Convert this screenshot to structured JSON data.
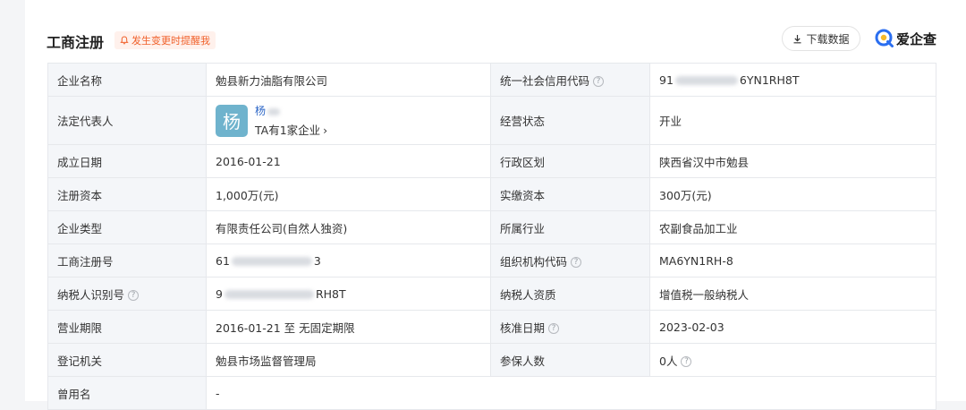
{
  "header": {
    "title": "工商注册",
    "remind_label": "发生变更时提醒我",
    "download_label": "下载数据",
    "brand_name": "爱企查",
    "bell_icon": "bell-icon",
    "download_icon": "download-icon",
    "brand_logo": "aiqicha-logo"
  },
  "rows": [
    {
      "l1": "企业名称",
      "v1": "勉县新力油脂有限公司",
      "l2": "统一社会信用代码",
      "v2_prefix": "91",
      "v2_suffix": "6YN1RH8T"
    },
    {
      "l1": "法定代表人",
      "avatar_char": "杨",
      "rep_name": "杨",
      "rep_sub": "TA有1家企业",
      "l2": "经营状态",
      "v2": "开业"
    },
    {
      "l1": "成立日期",
      "v1": "2016-01-21",
      "l2": "行政区划",
      "v2": "陕西省汉中市勉县"
    },
    {
      "l1": "注册资本",
      "v1": "1,000万(元)",
      "l2": "实缴资本",
      "v2": "300万(元)"
    },
    {
      "l1": "企业类型",
      "v1": "有限责任公司(自然人独资)",
      "l2": "所属行业",
      "v2": "农副食品加工业"
    },
    {
      "l1": "工商注册号",
      "v1_prefix": "61",
      "v1_suffix": "3",
      "l2": "组织机构代码",
      "v2": "MA6YN1RH-8"
    },
    {
      "l1": "纳税人识别号",
      "v1_prefix": "9",
      "v1_suffix": "RH8T",
      "l2": "纳税人资质",
      "v2": "增值税一般纳税人"
    },
    {
      "l1": "营业期限",
      "v1": "2016-01-21 至 无固定期限",
      "l2": "核准日期",
      "v2": "2023-02-03"
    },
    {
      "l1": "登记机关",
      "v1": "勉县市场监督管理局",
      "l2": "参保人数",
      "v2": "0人"
    },
    {
      "l1": "曾用名",
      "v1": "-"
    }
  ],
  "help_icon": "question-circle-icon",
  "chevron_icon": "chevron-right-icon"
}
